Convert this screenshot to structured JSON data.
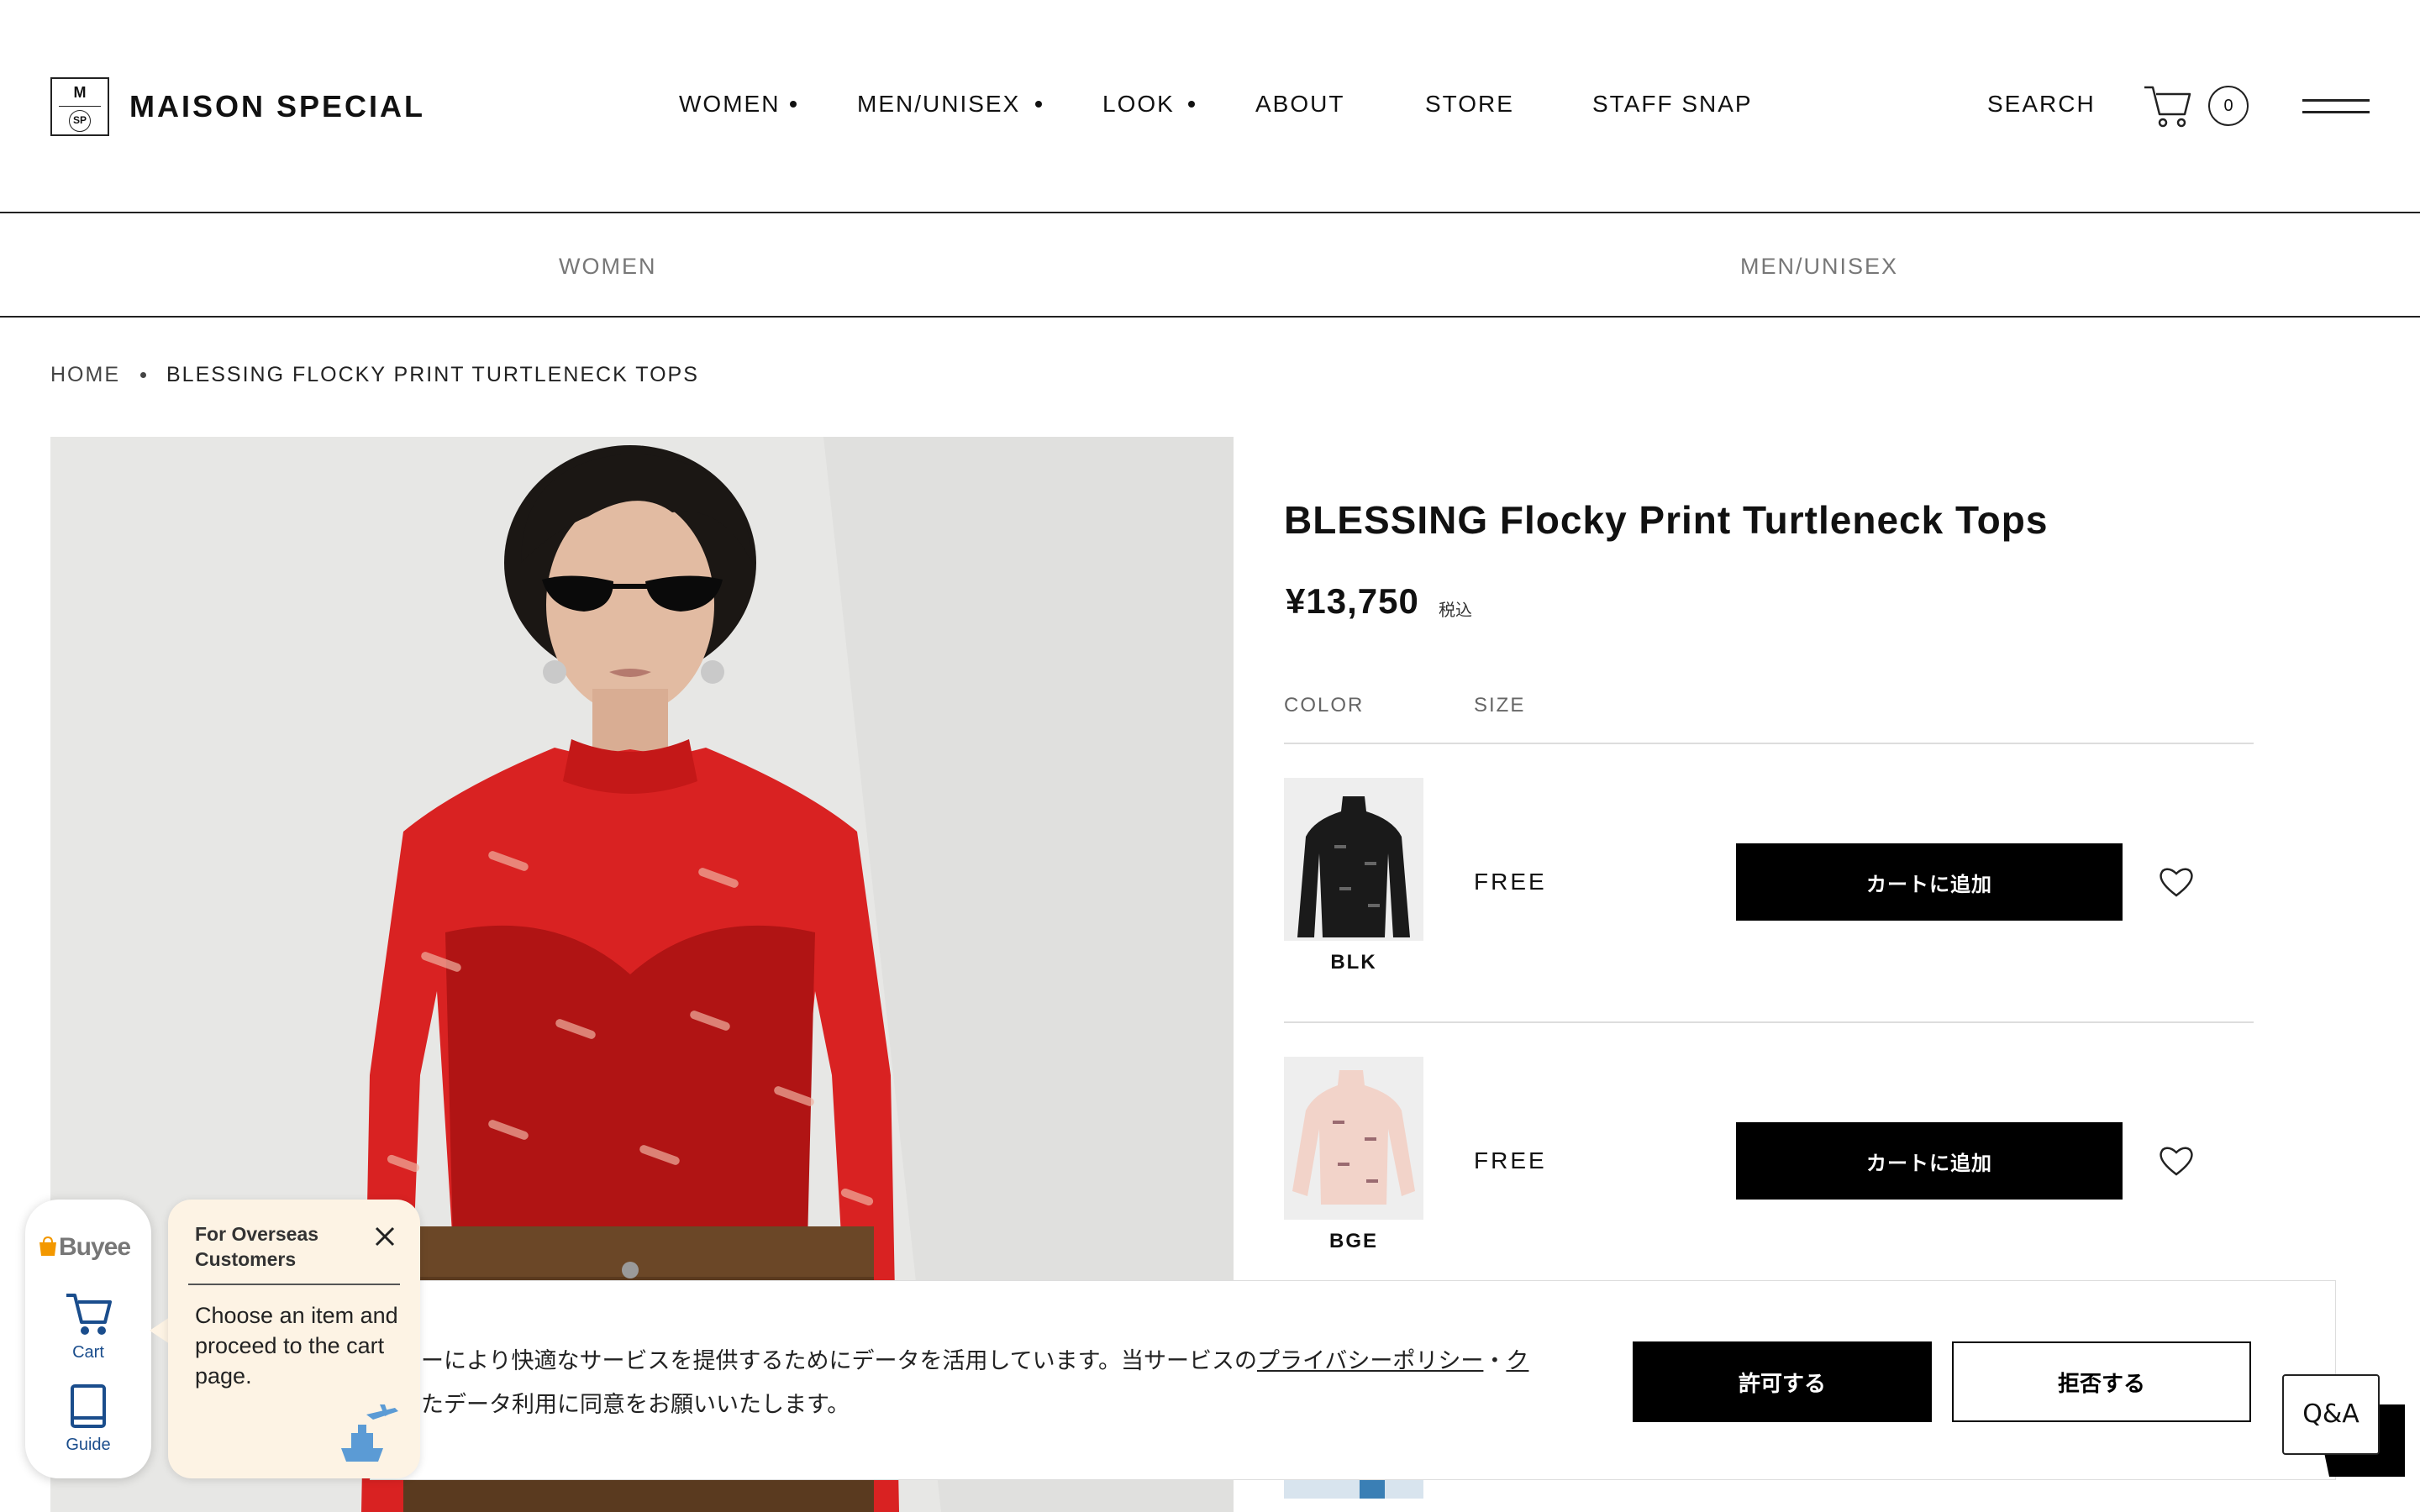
{
  "header": {
    "logo_m": "M",
    "logo_sp": "SP",
    "brand": "MAISON SPECIAL",
    "nav": [
      {
        "label": "WOMEN",
        "has_dot": true
      },
      {
        "label": "MEN/UNISEX",
        "has_dot": true
      },
      {
        "label": "LOOK",
        "has_dot": true
      },
      {
        "label": "ABOUT",
        "has_dot": false
      },
      {
        "label": "STORE",
        "has_dot": false
      },
      {
        "label": "STAFF SNAP",
        "has_dot": false
      }
    ],
    "search_label": "SEARCH",
    "cart_count": "0"
  },
  "subnav": {
    "items": [
      "WOMEN",
      "MEN/UNISEX"
    ]
  },
  "breadcrumb": {
    "home": "HOME",
    "current": "BLESSING FLOCKY PRINT TURTLENECK TOPS"
  },
  "product": {
    "title": "BLESSING Flocky Print Turtleneck Tops",
    "price": "¥13,750",
    "tax_label": "税込",
    "color_header": "COLOR",
    "size_header": "SIZE",
    "variants": [
      {
        "color": "BLK",
        "size": "FREE",
        "button": "カートに追加",
        "swatch_color": "#1a1a1a"
      },
      {
        "color": "BGE",
        "size": "FREE",
        "button": "カートに追加",
        "swatch_color": "#f2d3c9"
      }
    ]
  },
  "cookie": {
    "line1_a": "ーにより快適なサービスを提供するためにデータを活用しています。当サービスの",
    "line1_link1": "プライバシーポリシー",
    "line1_sep": "・",
    "line1_link2": "ク",
    "line2": "たデータ利用に同意をお願いいたします。",
    "accept": "許可する",
    "reject": "拒否する"
  },
  "buyee": {
    "logo": "Buyee",
    "cart_label": "Cart",
    "guide_label": "Guide",
    "tooltip_title": "For Overseas Customers",
    "tooltip_body": "Choose an item and proceed to the cart page."
  },
  "qa": {
    "label": "Q&A"
  },
  "colors": {
    "accent": "#000000",
    "photo_background": "#e6e6e4",
    "garment_red": "#d61f1f",
    "buyee_orange": "#f39800",
    "buyee_blue": "#1a4d8c",
    "tooltip_bg": "#fdf3e4"
  }
}
